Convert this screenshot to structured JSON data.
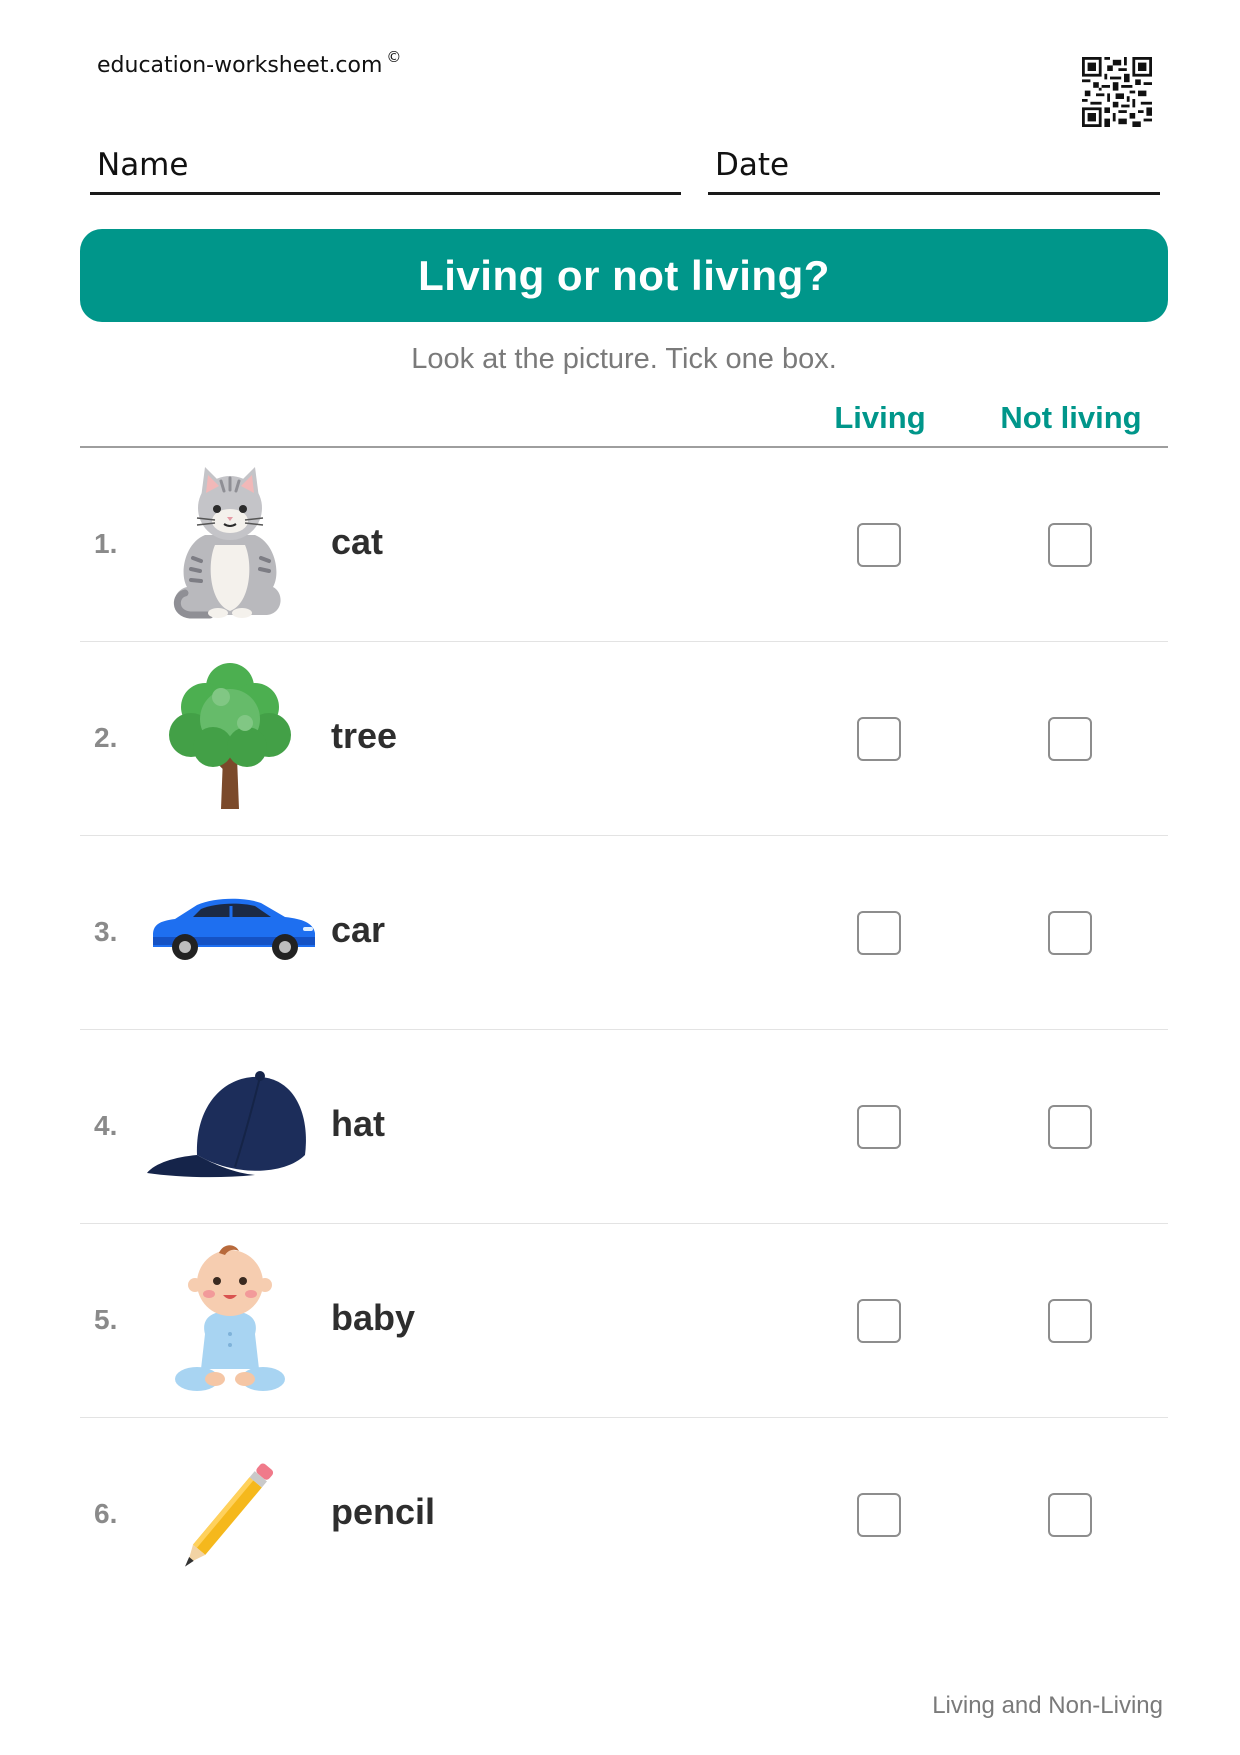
{
  "header": {
    "site": "education-worksheet.com",
    "copyright": "©",
    "name_label": "Name",
    "date_label": "Date"
  },
  "title": "Living or not living?",
  "instruction": "Look at the picture. Tick one box.",
  "columns": {
    "living": "Living",
    "not_living": "Not living"
  },
  "items": [
    {
      "number": "1.",
      "word": "cat",
      "icon": "cat-icon"
    },
    {
      "number": "2.",
      "word": "tree",
      "icon": "tree-icon"
    },
    {
      "number": "3.",
      "word": "car",
      "icon": "car-icon"
    },
    {
      "number": "4.",
      "word": "hat",
      "icon": "cap-hat-icon"
    },
    {
      "number": "5.",
      "word": "baby",
      "icon": "baby-icon"
    },
    {
      "number": "6.",
      "word": "pencil",
      "icon": "pencil-icon"
    }
  ],
  "footer": "Living and Non-Living",
  "colors": {
    "accent": "#00968a",
    "muted_text": "#7a7a7a",
    "checkbox_border": "#8d8d8d"
  }
}
